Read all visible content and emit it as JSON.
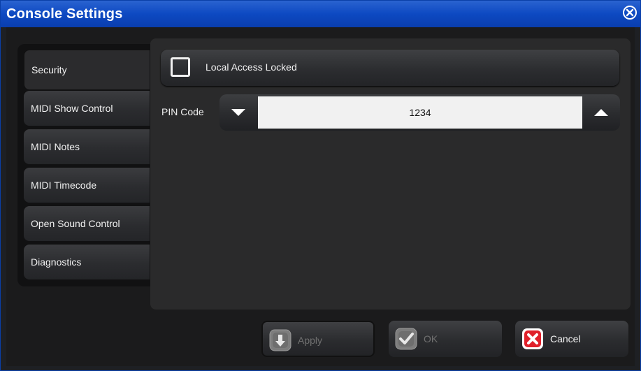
{
  "window": {
    "title": "Console Settings"
  },
  "tabs": [
    {
      "label": "Security",
      "active": true
    },
    {
      "label": "MIDI Show Control",
      "active": false
    },
    {
      "label": "MIDI Notes",
      "active": false
    },
    {
      "label": "MIDI Timecode",
      "active": false
    },
    {
      "label": "Open Sound Control",
      "active": false
    },
    {
      "label": "Diagnostics",
      "active": false
    }
  ],
  "security": {
    "local_access_label": "Local Access Locked",
    "local_access_checked": false,
    "pin_label": "PIN Code",
    "pin_value": "1234"
  },
  "buttons": {
    "apply": {
      "label": "Apply",
      "enabled": false
    },
    "ok": {
      "label": "OK",
      "enabled": false
    },
    "cancel": {
      "label": "Cancel",
      "enabled": true
    }
  },
  "colors": {
    "titlebar": "#0d49c2",
    "cancel_icon": "#e0202a"
  },
  "icons": {
    "close": "close-circle-icon",
    "step_down": "triangle-down-icon",
    "step_up": "triangle-up-icon",
    "apply": "arrow-down-icon",
    "ok": "checkmark-icon",
    "cancel": "x-icon"
  }
}
